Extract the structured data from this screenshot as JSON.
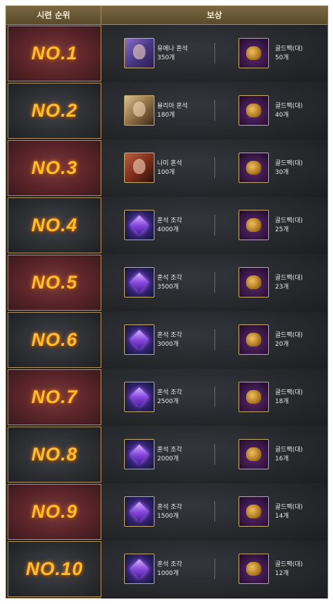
{
  "header": {
    "rank_col": "시련 순위",
    "reward_col": "보상"
  },
  "rows": [
    {
      "rank": "NO.1",
      "item1_label": "유에나 혼석",
      "item1_qty": "350개",
      "item2_label": "골드팩(대)",
      "item2_qty": "50개"
    },
    {
      "rank": "NO.2",
      "item1_label": "율리아 혼석",
      "item1_qty": "180개",
      "item2_label": "골드팩(대)",
      "item2_qty": "40개"
    },
    {
      "rank": "NO.3",
      "item1_label": "나미 혼석",
      "item1_qty": "100개",
      "item2_label": "골드팩(대)",
      "item2_qty": "30개"
    },
    {
      "rank": "NO.4",
      "item1_label": "혼석 조각",
      "item1_qty": "4000개",
      "item2_label": "골드팩(대)",
      "item2_qty": "25개"
    },
    {
      "rank": "NO.5",
      "item1_label": "혼석 조각",
      "item1_qty": "3500개",
      "item2_label": "골드팩(대)",
      "item2_qty": "23개"
    },
    {
      "rank": "NO.6",
      "item1_label": "혼석 조각",
      "item1_qty": "3000개",
      "item2_label": "골드팩(대)",
      "item2_qty": "20개"
    },
    {
      "rank": "NO.7",
      "item1_label": "혼석 조각",
      "item1_qty": "2500개",
      "item2_label": "골드팩(대)",
      "item2_qty": "18개"
    },
    {
      "rank": "NO.8",
      "item1_label": "혼석 조각",
      "item1_qty": "2000개",
      "item2_label": "골드팩(대)",
      "item2_qty": "16개"
    },
    {
      "rank": "NO.9",
      "item1_label": "혼석 조각",
      "item1_qty": "1500개",
      "item2_label": "골드팩(대)",
      "item2_qty": "14개"
    },
    {
      "rank": "NO.10",
      "item1_label": "혼석 조각",
      "item1_qty": "1000개",
      "item2_label": "골드팩(대)",
      "item2_qty": "12개"
    }
  ],
  "icons": {
    "item1": [
      "yuena-portrait-icon",
      "yulia-portrait-icon",
      "nami-portrait-icon",
      "soulstone-shard-icon",
      "soulstone-shard-icon",
      "soulstone-shard-icon",
      "soulstone-shard-icon",
      "soulstone-shard-icon",
      "soulstone-shard-icon",
      "soulstone-shard-icon"
    ],
    "item2": "gold-pack-icon"
  },
  "colors": {
    "rank_text": "#ffbf2e",
    "header_bg": "#6a5936",
    "frame_border": "#8c7a55"
  }
}
